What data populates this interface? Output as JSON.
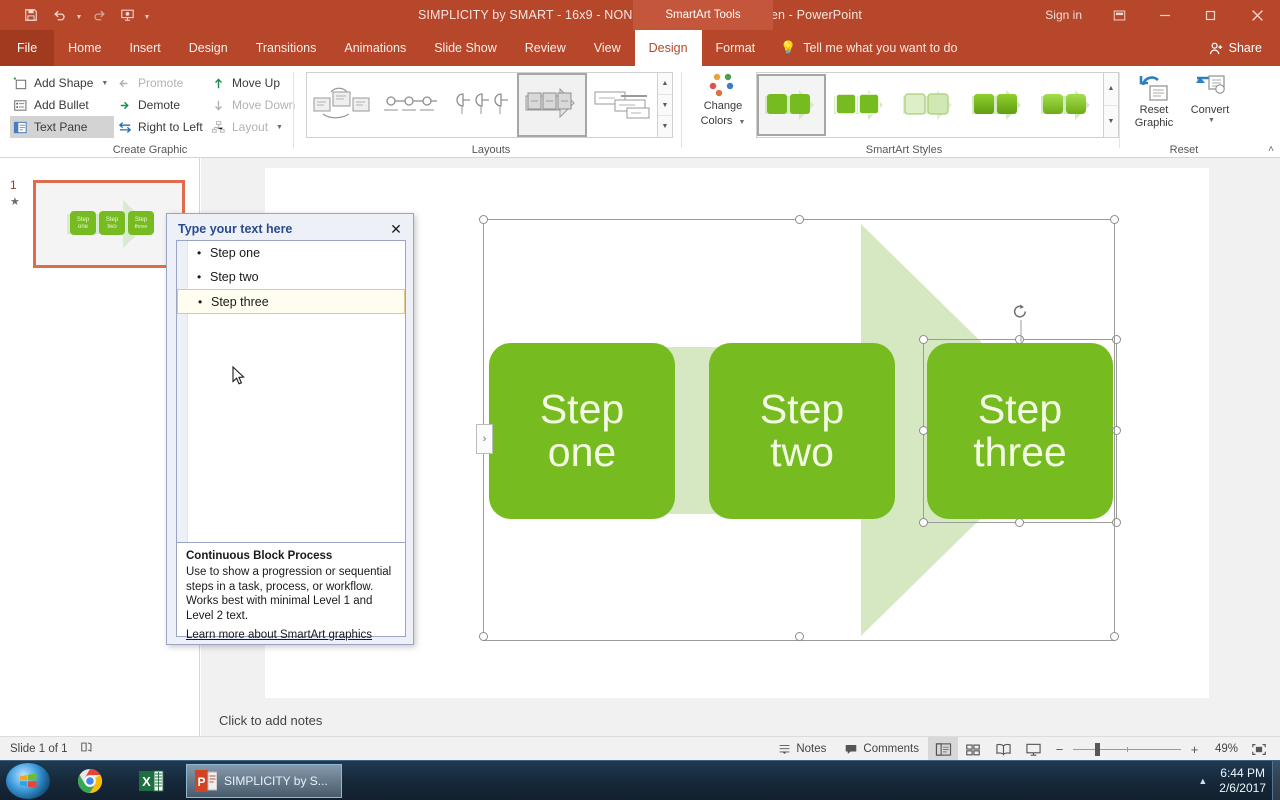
{
  "titlebar": {
    "quick_access": [
      {
        "name": "save-icon",
        "label": "Save"
      },
      {
        "name": "undo-icon",
        "label": "Undo"
      },
      {
        "name": "redo-icon",
        "label": "Redo"
      },
      {
        "name": "start-presentation-icon",
        "label": "Start From Beginning"
      },
      {
        "name": "customize-qat-icon",
        "label": "Customize Quick Access Toolbar"
      }
    ],
    "document_title": "SIMPLICITY by SMART - 16x9 - NON-ANIMATED - Fresh Green  -  PowerPoint",
    "contextual_tab_group": "SmartArt Tools",
    "sign_in": "Sign in",
    "window_buttons": [
      {
        "name": "ribbon-display-options-icon",
        "glyph": "⬚"
      },
      {
        "name": "minimize-icon",
        "glyph": "–"
      },
      {
        "name": "restore-icon",
        "glyph": "❐"
      },
      {
        "name": "close-icon",
        "glyph": "✕"
      }
    ]
  },
  "tabs": [
    {
      "label": "File",
      "active": false,
      "kind": "file"
    },
    {
      "label": "Home",
      "active": false
    },
    {
      "label": "Insert",
      "active": false
    },
    {
      "label": "Design",
      "active": false
    },
    {
      "label": "Transitions",
      "active": false
    },
    {
      "label": "Animations",
      "active": false
    },
    {
      "label": "Slide Show",
      "active": false
    },
    {
      "label": "Review",
      "active": false
    },
    {
      "label": "View",
      "active": false
    },
    {
      "label": "Design",
      "active": true,
      "contextual": true
    },
    {
      "label": "Format",
      "active": false,
      "contextual": true
    }
  ],
  "tell_me": {
    "placeholder": "Tell me what you want to do"
  },
  "share": {
    "label": "Share"
  },
  "ribbon": {
    "groups": [
      {
        "name": "create-graphic",
        "label": "Create Graphic",
        "columns": [
          [
            {
              "label": "Add Shape",
              "icon": "add-shape-icon",
              "state": "normal",
              "dropdown": true
            },
            {
              "label": "Add Bullet",
              "icon": "add-bullet-icon",
              "state": "normal"
            },
            {
              "label": "Text Pane",
              "icon": "text-pane-icon",
              "state": "selected"
            }
          ],
          [
            {
              "label": "Promote",
              "icon": "promote-icon",
              "state": "disabled"
            },
            {
              "label": "Demote",
              "icon": "demote-icon",
              "state": "normal"
            },
            {
              "label": "Right to Left",
              "icon": "right-to-left-icon",
              "state": "normal"
            }
          ],
          [
            {
              "label": "Move Up",
              "icon": "move-up-icon",
              "state": "normal"
            },
            {
              "label": "Move Down",
              "icon": "move-down-icon",
              "state": "disabled"
            },
            {
              "label": "Layout",
              "icon": "layout-icon",
              "state": "disabled",
              "dropdown": true
            }
          ]
        ]
      },
      {
        "name": "layouts",
        "label": "Layouts",
        "items": [
          {
            "name": "layout-random-to-result-process",
            "selected": false
          },
          {
            "name": "layout-basic-timeline",
            "selected": false
          },
          {
            "name": "layout-circle-accent-timeline",
            "selected": false
          },
          {
            "name": "layout-continuous-block-process",
            "selected": true
          },
          {
            "name": "layout-increasing-circle-process",
            "selected": false
          }
        ],
        "scroll": [
          "scroll-up-icon",
          "scroll-down-icon",
          "more-layouts-icon"
        ]
      },
      {
        "name": "smartart-styles",
        "label": "SmartArt Styles",
        "change_colors": {
          "label_line1": "Change",
          "label_line2": "Colors",
          "dropdown": true
        },
        "items": [
          {
            "name": "style-simple-fill",
            "selected": true
          },
          {
            "name": "style-white-outline",
            "selected": false
          },
          {
            "name": "style-subtle-effect",
            "selected": false
          },
          {
            "name": "style-moderate-effect",
            "selected": false
          },
          {
            "name": "style-intense-effect",
            "selected": false
          }
        ],
        "scroll": [
          "scroll-up-icon",
          "scroll-down-icon"
        ]
      },
      {
        "name": "reset",
        "label": "Reset",
        "buttons": [
          {
            "name": "reset-graphic-button",
            "line1": "Reset",
            "line2": "Graphic"
          },
          {
            "name": "convert-button",
            "line1": "Convert",
            "line2": "",
            "dropdown": true
          }
        ]
      }
    ],
    "collapse_label": "˄"
  },
  "thumbnail_pane": {
    "slides": [
      {
        "number": "1",
        "star": "★",
        "selected": true
      }
    ]
  },
  "slide": {
    "smartart": {
      "layout_name": "Continuous Block Process",
      "boxes": [
        {
          "line1": "Step",
          "line2": "one",
          "selected": false
        },
        {
          "line1": "Step",
          "line2": "two",
          "selected": false
        },
        {
          "line1": "Step",
          "line2": "three",
          "selected": true
        }
      ],
      "colors": {
        "box_fill": "#76bc21",
        "box_text": "#f3fbe4",
        "arrow_fill": "#d6e8c2",
        "plate_fill": "#edf3e5"
      }
    },
    "pane_toggle_glyph": "›",
    "rotate_handle": "rotate-handle-icon"
  },
  "text_pane": {
    "title": "Type your text here",
    "close_glyph": "✕",
    "items": [
      {
        "text": "Step one",
        "active": false
      },
      {
        "text": "Step two",
        "active": false
      },
      {
        "text": "Step three",
        "active": true
      }
    ],
    "description": {
      "heading": "Continuous Block Process",
      "body": "Use to show a progression or sequential steps in a task, process, or workflow. Works best with minimal Level 1 and Level 2 text.",
      "link": "Learn more about SmartArt graphics"
    }
  },
  "notes": {
    "placeholder": "Click to add notes"
  },
  "status_bar": {
    "slide_counter": "Slide 1 of 1",
    "language_icon": "accessibility-check-icon",
    "notes_button": "Notes",
    "comments_button": "Comments",
    "views": [
      {
        "name": "normal-view-button",
        "active": true
      },
      {
        "name": "slide-sorter-view-button",
        "active": false
      },
      {
        "name": "reading-view-button",
        "active": false
      },
      {
        "name": "slide-show-button",
        "active": false
      }
    ],
    "zoom_out": "−",
    "zoom_in": "+",
    "zoom_level": "49%",
    "fit_to_window": "fit-slide-to-window-icon"
  },
  "taskbar": {
    "start": "windows-start-icon",
    "items": [
      {
        "name": "chrome-taskbar-icon",
        "label": "",
        "active": false
      },
      {
        "name": "excel-taskbar-icon",
        "label": "",
        "active": false
      },
      {
        "name": "powerpoint-taskbar-icon",
        "label": "SIMPLICITY by S...",
        "active": true
      }
    ],
    "tray_arrow": "▲",
    "clock_time": "6:44 PM",
    "clock_date": "2/6/2017"
  },
  "colors": {
    "office_red": "#b7472a",
    "contextual_tab_bg": "#c4573b",
    "accent_green": "#76bc21",
    "arrow_light_green": "#d6e8c2",
    "thumbnail_select": "#e06c4f"
  }
}
